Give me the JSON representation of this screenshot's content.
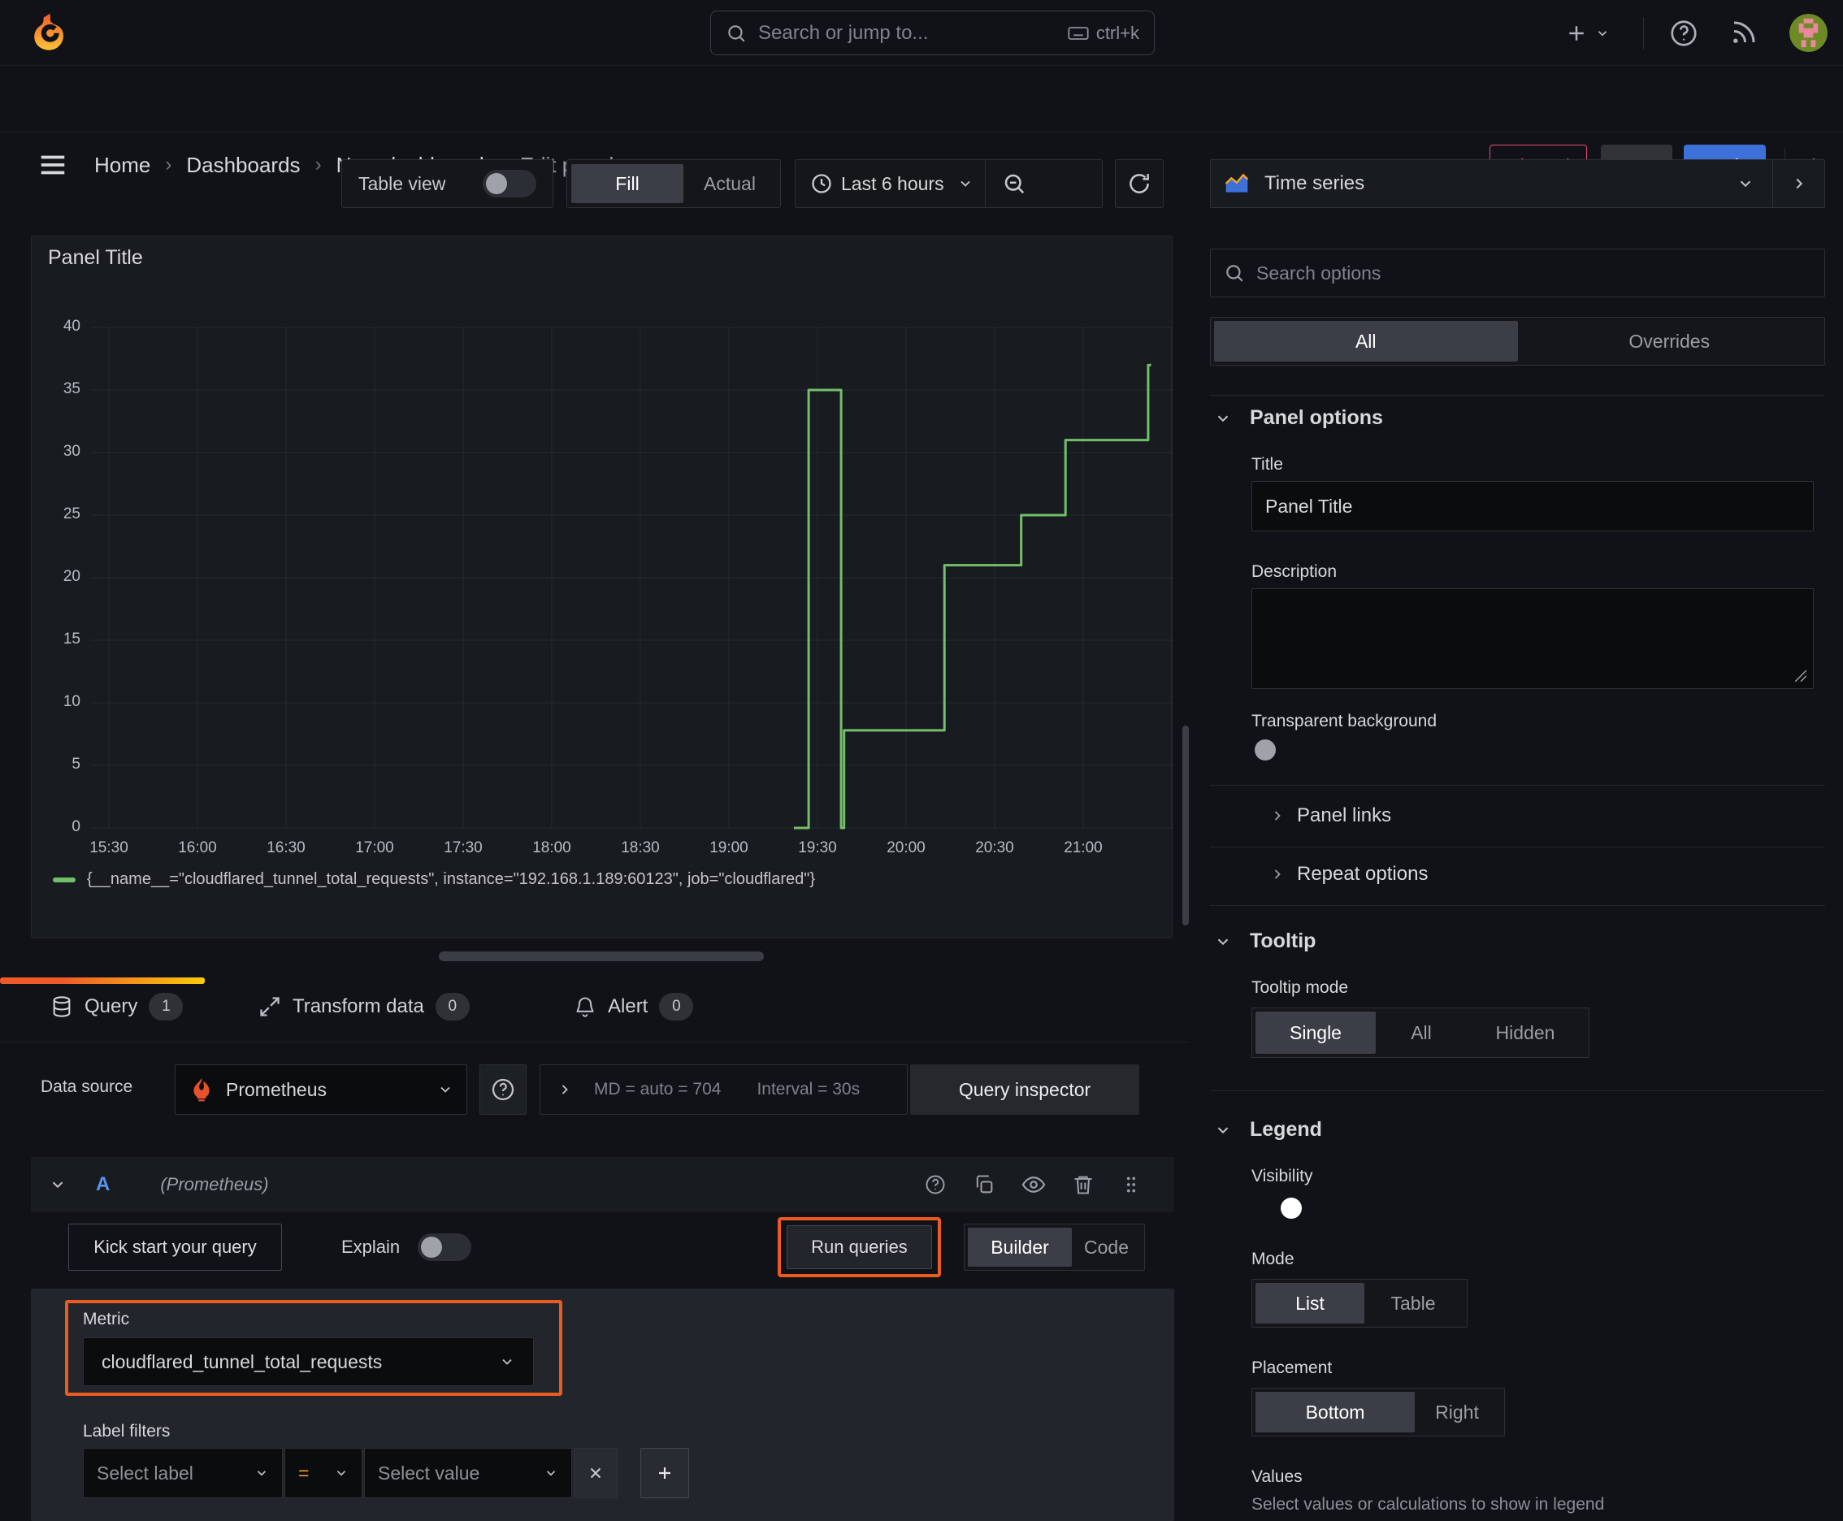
{
  "topbar": {
    "search_placeholder": "Search or jump to...",
    "shortcut": "ctrl+k"
  },
  "nav": {
    "breadcrumbs": [
      "Home",
      "Dashboards",
      "New dashboard",
      "Edit panel"
    ],
    "discard": "Discard",
    "save": "Save",
    "apply": "Apply"
  },
  "toolbar": {
    "table_view": "Table view",
    "fill": "Fill",
    "actual": "Actual",
    "time_range": "Last 6 hours"
  },
  "panel": {
    "title": "Panel Title"
  },
  "chart_data": {
    "type": "line",
    "line_style": "step",
    "title": "Panel Title",
    "color": "#73bf69",
    "grid": true,
    "legend_position": "bottom",
    "ylim": [
      0,
      40
    ],
    "y_ticks": [
      0,
      5,
      10,
      15,
      20,
      25,
      30,
      35,
      40
    ],
    "x_ticks": [
      "15:30",
      "16:00",
      "16:30",
      "17:00",
      "17:30",
      "18:00",
      "18:30",
      "19:00",
      "19:30",
      "20:00",
      "20:30",
      "21:00"
    ],
    "x_grid_extra": [
      "21:30"
    ],
    "x_range": [
      "15:24",
      "21:31"
    ],
    "series": [
      {
        "name": "{__name__=\"cloudflared_tunnel_total_requests\", instance=\"192.168.1.189:60123\", job=\"cloudflared\"}",
        "points": [
          [
            "19:22",
            0
          ],
          [
            "19:27",
            0
          ],
          [
            "19:27",
            35
          ],
          [
            "19:38",
            35
          ],
          [
            "19:38",
            0
          ],
          [
            "19:39",
            0
          ],
          [
            "19:39",
            7.8
          ],
          [
            "20:13",
            7.8
          ],
          [
            "20:13",
            21
          ],
          [
            "20:39",
            21
          ],
          [
            "20:39",
            25
          ],
          [
            "20:54",
            25
          ],
          [
            "20:54",
            31
          ],
          [
            "21:22",
            31
          ],
          [
            "21:22",
            37
          ],
          [
            "21:23",
            37
          ]
        ]
      }
    ]
  },
  "tabs": {
    "query": "Query",
    "query_count": "1",
    "transform": "Transform data",
    "transform_count": "0",
    "alert": "Alert",
    "alert_count": "0"
  },
  "datasource": {
    "label": "Data source",
    "name": "Prometheus",
    "md": "MD = auto = 704",
    "interval": "Interval = 30s",
    "inspector": "Query inspector"
  },
  "query": {
    "ref": "A",
    "hint": "(Prometheus)",
    "kick_start": "Kick start your query",
    "explain": "Explain",
    "run": "Run queries",
    "builder": "Builder",
    "code": "Code"
  },
  "editor": {
    "metric_label": "Metric",
    "metric_value": "cloudflared_tunnel_total_requests",
    "filters_label": "Label filters",
    "select_label": "Select label",
    "op": "=",
    "select_value": "Select value"
  },
  "sidebar": {
    "viz": "Time series",
    "search_placeholder": "Search options",
    "filter_tabs": {
      "all": "All",
      "overrides": "Overrides"
    },
    "panel_options": {
      "heading": "Panel options",
      "title_label": "Title",
      "title_value": "Panel Title",
      "description_label": "Description",
      "transparent": "Transparent background",
      "links": "Panel links",
      "repeat": "Repeat options"
    },
    "tooltip": {
      "heading": "Tooltip",
      "mode_label": "Tooltip mode",
      "options": [
        "Single",
        "All",
        "Hidden"
      ]
    },
    "legend": {
      "heading": "Legend",
      "visibility": "Visibility",
      "mode_label": "Mode",
      "modes": [
        "List",
        "Table"
      ],
      "placement_label": "Placement",
      "placements": [
        "Bottom",
        "Right"
      ],
      "values_label": "Values",
      "values_hint": "Select values or calculations to show in legend"
    }
  },
  "colors": {
    "accent_blue": "#3d71d9",
    "series_green": "#73bf69",
    "highlight_orange": "#ea5b22",
    "danger_pink": "#e84c77",
    "tab_gradient": [
      "#f05a28",
      "#fbca0a"
    ]
  }
}
